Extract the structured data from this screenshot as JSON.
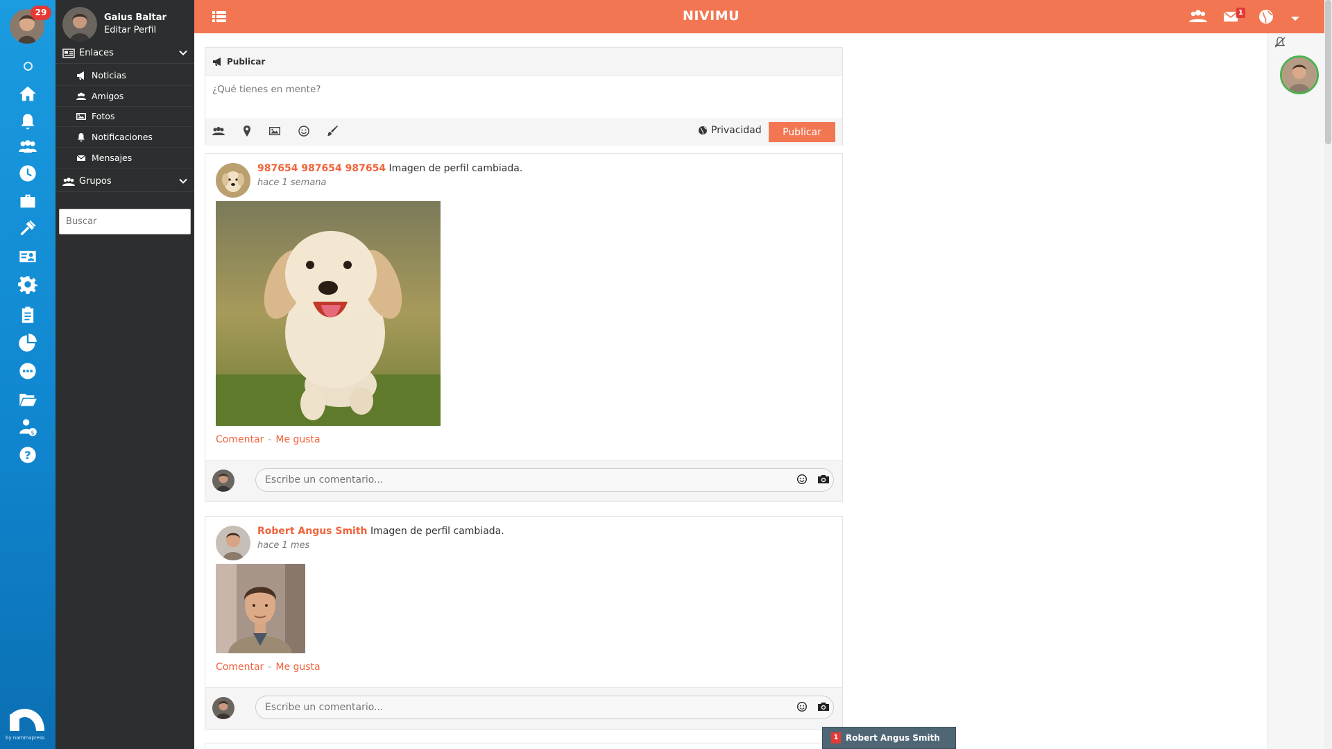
{
  "app": {
    "brand": "NIVIMU",
    "accent_color": "#f37652",
    "rail_color": "#1592da",
    "sidebar_color": "#2d2e2f"
  },
  "rail": {
    "notification_count": "29",
    "icons": [
      "circle-icon",
      "home-icon",
      "bell-icon",
      "users-icon",
      "clock-icon",
      "briefcase-icon",
      "tools-icon",
      "id-card-icon",
      "gear-icon",
      "clipboard-icon",
      "pie-chart-icon",
      "chat-icon",
      "folder-icon",
      "user-dollar-icon",
      "help-icon"
    ],
    "vendor": "by nammapress"
  },
  "sidebar": {
    "user_name": "Gaius Baltar",
    "edit_profile": "Editar Perfil",
    "links_section": "Enlaces",
    "links": [
      {
        "label": "Noticias",
        "icon": "megaphone-icon"
      },
      {
        "label": "Amigos",
        "icon": "users-icon"
      },
      {
        "label": "Fotos",
        "icon": "image-icon"
      },
      {
        "label": "Notificaciones",
        "icon": "bell-icon"
      },
      {
        "label": "Mensajes",
        "icon": "envelope-icon"
      }
    ],
    "groups_section": "Grupos",
    "search_placeholder": "Buscar"
  },
  "topbar": {
    "message_count": "1",
    "icons": [
      "menu-icon",
      "friends-icon",
      "messages-icon",
      "globe-icon",
      "caret-down-icon"
    ]
  },
  "publish": {
    "header": "Publicar",
    "placeholder": "¿Qué tienes en mente?",
    "privacy": "Privacidad",
    "button": "Publicar",
    "tools": [
      "group-icon",
      "location-icon",
      "photo-icon",
      "emoji-icon",
      "brush-icon"
    ]
  },
  "posts": [
    {
      "author": "987654 987654 987654",
      "action": "Imagen de perfil cambiada.",
      "time": "hace 1 semana",
      "image": "puppy-photo",
      "comment": "Comentar",
      "like": "Me gusta",
      "comment_placeholder": "Escribe un comentario..."
    },
    {
      "author": "Robert Angus Smith",
      "action": "Imagen de perfil cambiada.",
      "time": "hace 1 mes",
      "image": "man-portrait-photo",
      "comment": "Comentar",
      "like": "Me gusta",
      "comment_placeholder": "Escribe un comentario..."
    }
  ],
  "chat": {
    "count": "1",
    "name": "Robert Angus Smith"
  }
}
